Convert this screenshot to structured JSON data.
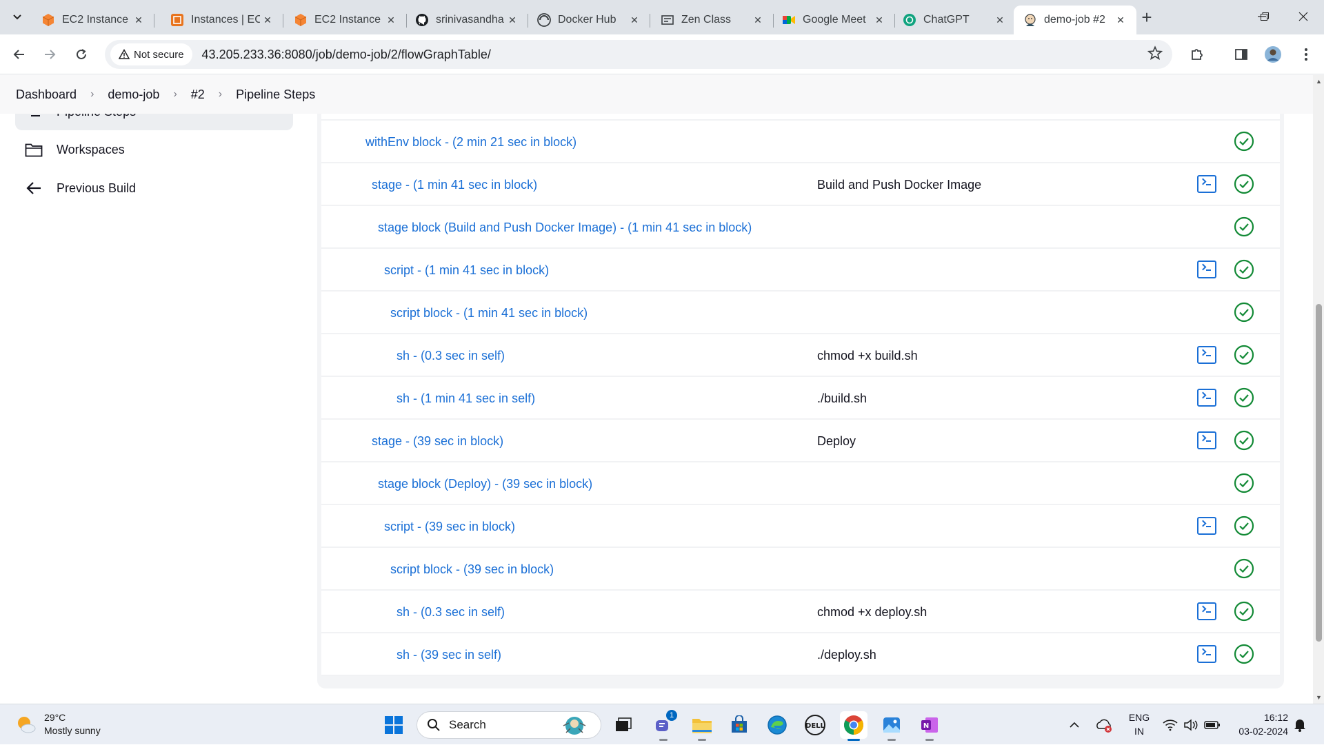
{
  "browser": {
    "tabs": [
      {
        "title": "EC2 Instance",
        "icon": "aws-orange-cube-icon",
        "active": false
      },
      {
        "title": "Instances | EC",
        "icon": "aws-orange-square-icon",
        "active": false
      },
      {
        "title": "EC2 Instance",
        "icon": "aws-orange-cube-icon",
        "active": false
      },
      {
        "title": "srinivasandha",
        "icon": "github-icon",
        "active": false
      },
      {
        "title": "Docker Hub",
        "icon": "docker-hub-icon",
        "active": false
      },
      {
        "title": "Zen Class",
        "icon": "zen-class-icon",
        "active": false
      },
      {
        "title": "Google Meet",
        "icon": "google-meet-icon",
        "active": false
      },
      {
        "title": "ChatGPT",
        "icon": "chatgpt-icon",
        "active": false
      },
      {
        "title": "demo-job #2",
        "icon": "jenkins-icon",
        "active": true
      }
    ],
    "security_label": "Not secure",
    "url": "43.205.233.36:8080/job/demo-job/2/flowGraphTable/"
  },
  "breadcrumb": {
    "items": [
      "Dashboard",
      "demo-job",
      "#2",
      "Pipeline Steps"
    ]
  },
  "sidebar": {
    "active_item": "Pipeline Steps",
    "items": [
      {
        "label": "Workspaces",
        "icon": "folder-icon"
      },
      {
        "label": "Previous Build",
        "icon": "arrow-left-icon"
      }
    ]
  },
  "steps": [
    {
      "name": "withEnv block - (2 min 21 sec in block)",
      "indent": 0,
      "args": "",
      "console": false,
      "status": "success"
    },
    {
      "name": "stage - (1 min 41 sec in block)",
      "indent": 1,
      "args": "Build and Push Docker Image",
      "console": true,
      "status": "success"
    },
    {
      "name": "stage block (Build and Push Docker Image) - (1 min 41 sec in block)",
      "indent": 2,
      "args": "",
      "console": false,
      "status": "success"
    },
    {
      "name": "script - (1 min 41 sec in block)",
      "indent": 3,
      "args": "",
      "console": true,
      "status": "success"
    },
    {
      "name": "script block - (1 min 41 sec in block)",
      "indent": 4,
      "args": "",
      "console": false,
      "status": "success"
    },
    {
      "name": "sh - (0.3 sec in self)",
      "indent": 5,
      "args": "chmod +x build.sh",
      "console": true,
      "status": "success"
    },
    {
      "name": "sh - (1 min 41 sec in self)",
      "indent": 5,
      "args": "./build.sh",
      "console": true,
      "status": "success"
    },
    {
      "name": "stage - (39 sec in block)",
      "indent": 1,
      "args": "Deploy",
      "console": true,
      "status": "success"
    },
    {
      "name": "stage block (Deploy) - (39 sec in block)",
      "indent": 2,
      "args": "",
      "console": false,
      "status": "success"
    },
    {
      "name": "script - (39 sec in block)",
      "indent": 3,
      "args": "",
      "console": true,
      "status": "success"
    },
    {
      "name": "script block - (39 sec in block)",
      "indent": 4,
      "args": "",
      "console": false,
      "status": "success"
    },
    {
      "name": "sh - (0.3 sec in self)",
      "indent": 5,
      "args": "chmod +x deploy.sh",
      "console": true,
      "status": "success"
    },
    {
      "name": "sh - (39 sec in self)",
      "indent": 5,
      "args": "./deploy.sh",
      "console": true,
      "status": "success"
    }
  ],
  "colors": {
    "link": "#1a6fd6",
    "success": "#138a36"
  },
  "taskbar": {
    "weather": {
      "temp": "29°C",
      "condition": "Mostly sunny"
    },
    "search_placeholder": "Search",
    "chat_badge": "1",
    "language": "ENG",
    "region": "IN",
    "time": "16:12",
    "date": "03-02-2024"
  }
}
